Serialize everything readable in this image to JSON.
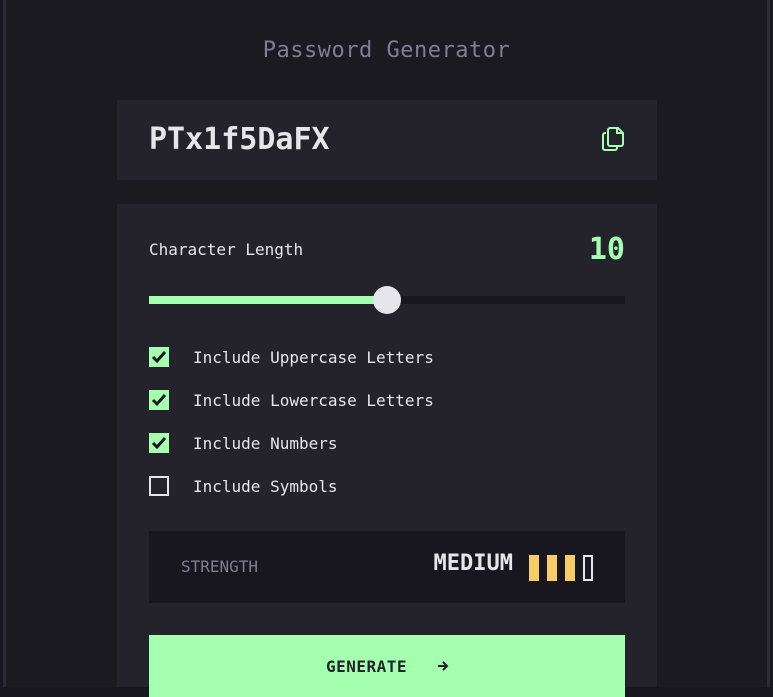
{
  "app": {
    "title": "Password Generator"
  },
  "output": {
    "password": "PTx1f5DaFX",
    "copy_icon": "copy-icon"
  },
  "settings": {
    "length_label": "Character Length",
    "length_value": "10",
    "slider_fraction": 0.5
  },
  "options": [
    {
      "label": "Include Uppercase Letters",
      "checked": true
    },
    {
      "label": "Include Lowercase Letters",
      "checked": true
    },
    {
      "label": "Include Numbers",
      "checked": true
    },
    {
      "label": "Include Symbols",
      "checked": false
    }
  ],
  "strength": {
    "label": "STRENGTH",
    "value": "MEDIUM",
    "level": 3,
    "max_level": 4,
    "color": "#f8cd65"
  },
  "generate": {
    "label": "GENERATE",
    "icon": "arrow-right-icon"
  },
  "colors": {
    "accent": "#a4ffaf",
    "panel": "#24232c",
    "background": "#18171f",
    "text": "#e6e5ea",
    "muted": "#817d92"
  }
}
